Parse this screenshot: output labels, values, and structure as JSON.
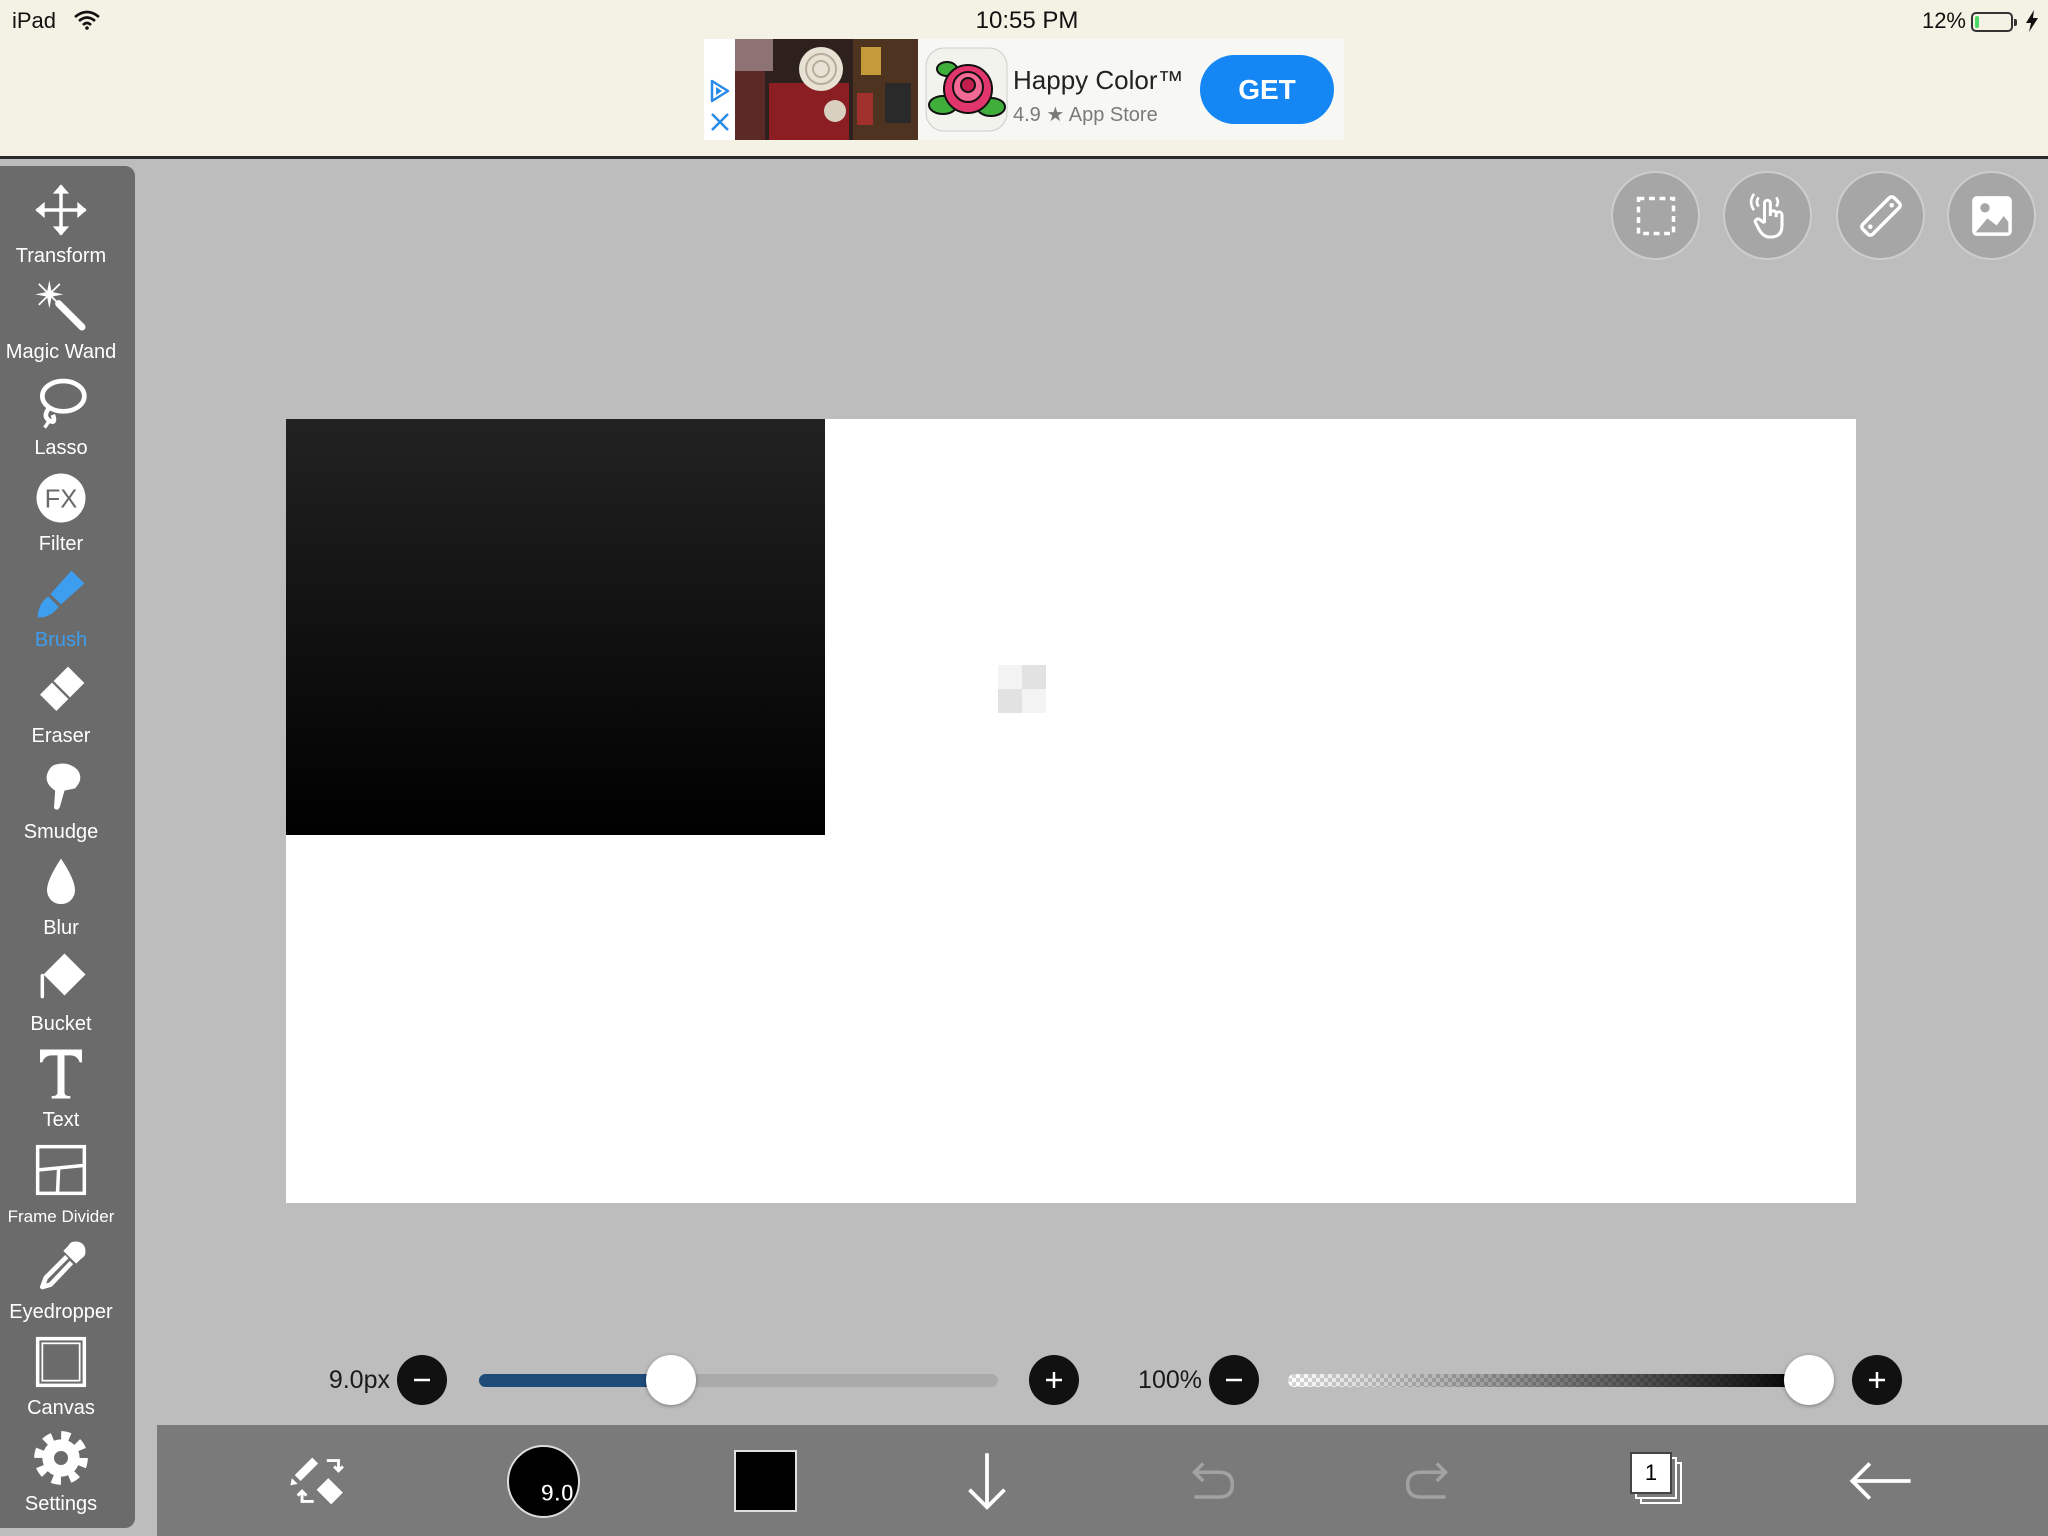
{
  "status_bar": {
    "device": "iPad",
    "time": "10:55 PM",
    "battery_text": "12%",
    "battery_level": 0.12,
    "icons": [
      "wifi-icon",
      "battery-icon",
      "charging-bolt-icon"
    ]
  },
  "ad": {
    "title": "Happy Color™",
    "rating": "4.9",
    "rating_star": "★",
    "store": "App Store",
    "cta": "GET",
    "icons": [
      "ad-choices-icon",
      "ad-close-icon"
    ]
  },
  "tools": [
    {
      "label": "Transform",
      "icon": "move-icon"
    },
    {
      "label": "Magic Wand",
      "icon": "magic-wand-icon"
    },
    {
      "label": "Lasso",
      "icon": "lasso-icon"
    },
    {
      "label": "Filter",
      "icon": "filter-icon",
      "badge": "FX"
    },
    {
      "label": "Brush",
      "icon": "brush-icon",
      "active": true
    },
    {
      "label": "Eraser",
      "icon": "eraser-icon"
    },
    {
      "label": "Smudge",
      "icon": "smudge-icon"
    },
    {
      "label": "Blur",
      "icon": "blur-icon"
    },
    {
      "label": "Bucket",
      "icon": "bucket-icon"
    },
    {
      "label": "Text",
      "icon": "text-icon"
    },
    {
      "label": "Frame Divider",
      "icon": "frame-divider-icon"
    },
    {
      "label": "Eyedropper",
      "icon": "eyedropper-icon"
    },
    {
      "label": "Canvas",
      "icon": "canvas-icon"
    },
    {
      "label": "Settings",
      "icon": "gear-icon"
    }
  ],
  "top_buttons": [
    {
      "icon": "selection-icon"
    },
    {
      "icon": "hand-touch-icon"
    },
    {
      "icon": "ruler-icon"
    },
    {
      "icon": "image-icon"
    }
  ],
  "brush_size": {
    "label": "9.0px",
    "level": 0.37
  },
  "opacity": {
    "label": "100%",
    "level": 1.0
  },
  "bottom_bar": {
    "brush_preview": "9.0",
    "layer_count": "1",
    "icons": [
      "brush-eraser-swap-icon",
      "brush-preview",
      "color-swatch",
      "download-arrow-icon",
      "undo-icon",
      "redo-icon",
      "layers-icon",
      "back-arrow-icon"
    ]
  },
  "colors": {
    "active_tool": "#3d9ef0",
    "current_color": "#000000",
    "toolbar": "#6b6b6b",
    "workspace": "#bdbdbd",
    "size_slider_fill": "#1e4b78",
    "ad_cta": "#1487f5"
  }
}
